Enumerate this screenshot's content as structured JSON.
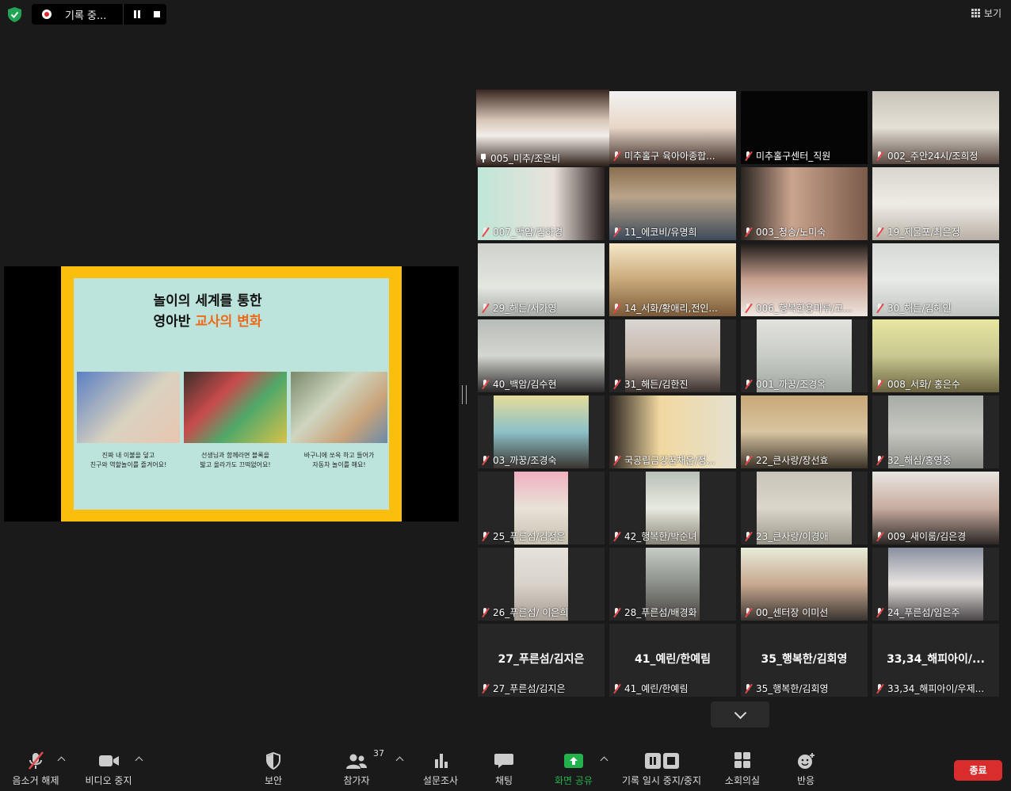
{
  "recording": {
    "label": "기록 중..."
  },
  "view_button": {
    "label": "보기"
  },
  "slide": {
    "title_line1": "놀이의 세계를 통한",
    "title_line2_prefix": "영아반 ",
    "title_line2_highlight": "교사의 변화",
    "captions": [
      "진짜 내 이불을 덮고\n친구와 역할놀이를 즐겨어요!",
      "선생님과 함께라면 블록을\n밟고 올라가도 끄떡없어요!",
      "바구니에 쏘옥 하고 들어가\n자동차 놀이를 해요!"
    ]
  },
  "participants": [
    {
      "name": "005_미추/조은비",
      "active": true,
      "pinned": true
    },
    {
      "name": "미추홀구 육아아종합..."
    },
    {
      "name": "미추홀구센터_직원"
    },
    {
      "name": "002_주안24시/조희정"
    },
    {
      "name": "007_백암/김하경"
    },
    {
      "name": "11_에코비/유명희"
    },
    {
      "name": "003_청송/노미숙"
    },
    {
      "name": "19_제물포/최은정"
    },
    {
      "name": "29_해든/서가영"
    },
    {
      "name": "14_서화/황애리,전인..."
    },
    {
      "name": "006_행복한용마루/고..."
    },
    {
      "name": "30_해든/김혜인"
    },
    {
      "name": "40_백암/김수현"
    },
    {
      "name": "31_해든/김한진"
    },
    {
      "name": "001_까꿍/조경옥"
    },
    {
      "name": "008_서화/ 홍은수"
    },
    {
      "name": "03_까꿍/조경숙"
    },
    {
      "name": "국공립금강꿈채운/정..."
    },
    {
      "name": "22_큰사랑/장선효"
    },
    {
      "name": "32_해심/홍영중"
    },
    {
      "name": "25_푸른섬/김정은"
    },
    {
      "name": "42_행복한/박순녀"
    },
    {
      "name": "23_큰사랑/이경애"
    },
    {
      "name": "009_새이룸/김은경"
    },
    {
      "name": "26_푸른섬/ 이은희"
    },
    {
      "name": "28_푸른섬/배경화"
    },
    {
      "name": "00_센터장 이미선"
    },
    {
      "name": "24_푸른섬/임은주"
    },
    {
      "name": "27_푸른섬/김지은",
      "display": "27_푸른섬/김지은"
    },
    {
      "name": "41_예린/한예림",
      "display": "41_예린/한예림"
    },
    {
      "name": "35_행복한/김회영",
      "display": "35_행복한/김회영"
    },
    {
      "name": "33,34_해피아이/우제...",
      "display": "33,34_해피아이/..."
    }
  ],
  "toolbar": {
    "unmute": "음소거 해제",
    "stop_video": "비디오 중지",
    "security": "보안",
    "participants": "참가자",
    "participants_count": "37",
    "polls": "설문조사",
    "chat": "채팅",
    "share_screen": "화면 공유",
    "pause_recording": "기록 일시 중지/중지",
    "breakout": "소회의실",
    "reactions": "반응",
    "end": "종료"
  },
  "colors": {
    "share_green": "#22b14c",
    "end_red": "#d92c2c",
    "active_outline": "#c9dc4a"
  }
}
